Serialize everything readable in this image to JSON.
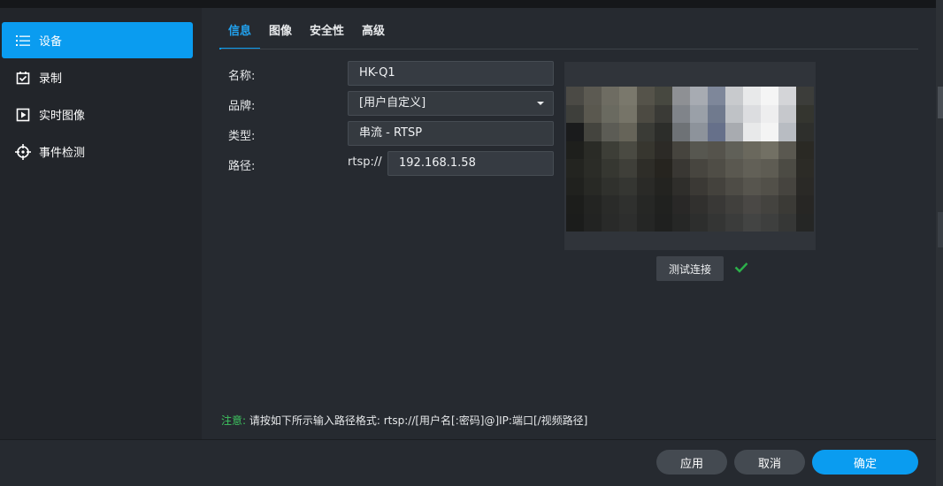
{
  "sidebar": {
    "items": [
      {
        "label": "设备",
        "icon": "list-icon",
        "active": true
      },
      {
        "label": "录制",
        "icon": "calendar-check-icon",
        "active": false
      },
      {
        "label": "实时图像",
        "icon": "play-square-icon",
        "active": false
      },
      {
        "label": "事件检测",
        "icon": "crosshair-icon",
        "active": false
      }
    ]
  },
  "tabs": [
    {
      "label": "信息",
      "active": true
    },
    {
      "label": "图像",
      "active": false
    },
    {
      "label": "安全性",
      "active": false
    },
    {
      "label": "高级",
      "active": false
    }
  ],
  "form": {
    "name": {
      "label": "名称:",
      "value": "HK-Q1"
    },
    "brand": {
      "label": "品牌:",
      "value": "[用户自定义]"
    },
    "type": {
      "label": "类型:",
      "value": "串流 - RTSP"
    },
    "path": {
      "label": "路径:",
      "prefix": "rtsp://",
      "value": "192.168.1.58"
    }
  },
  "preview": {
    "test_button": "测试连接",
    "status_icon": "checkmark-icon",
    "status_color": "#2cb04a"
  },
  "note": {
    "prefix": "注意:",
    "text": "请按如下所示输入路径格式: rtsp://[用户名[:密码]@]IP:端口[/视频路径]"
  },
  "footer": {
    "apply": "应用",
    "cancel": "取消",
    "ok": "确定"
  },
  "colors": {
    "accent": "#0a9cf0",
    "note_green": "#3ec45f"
  }
}
